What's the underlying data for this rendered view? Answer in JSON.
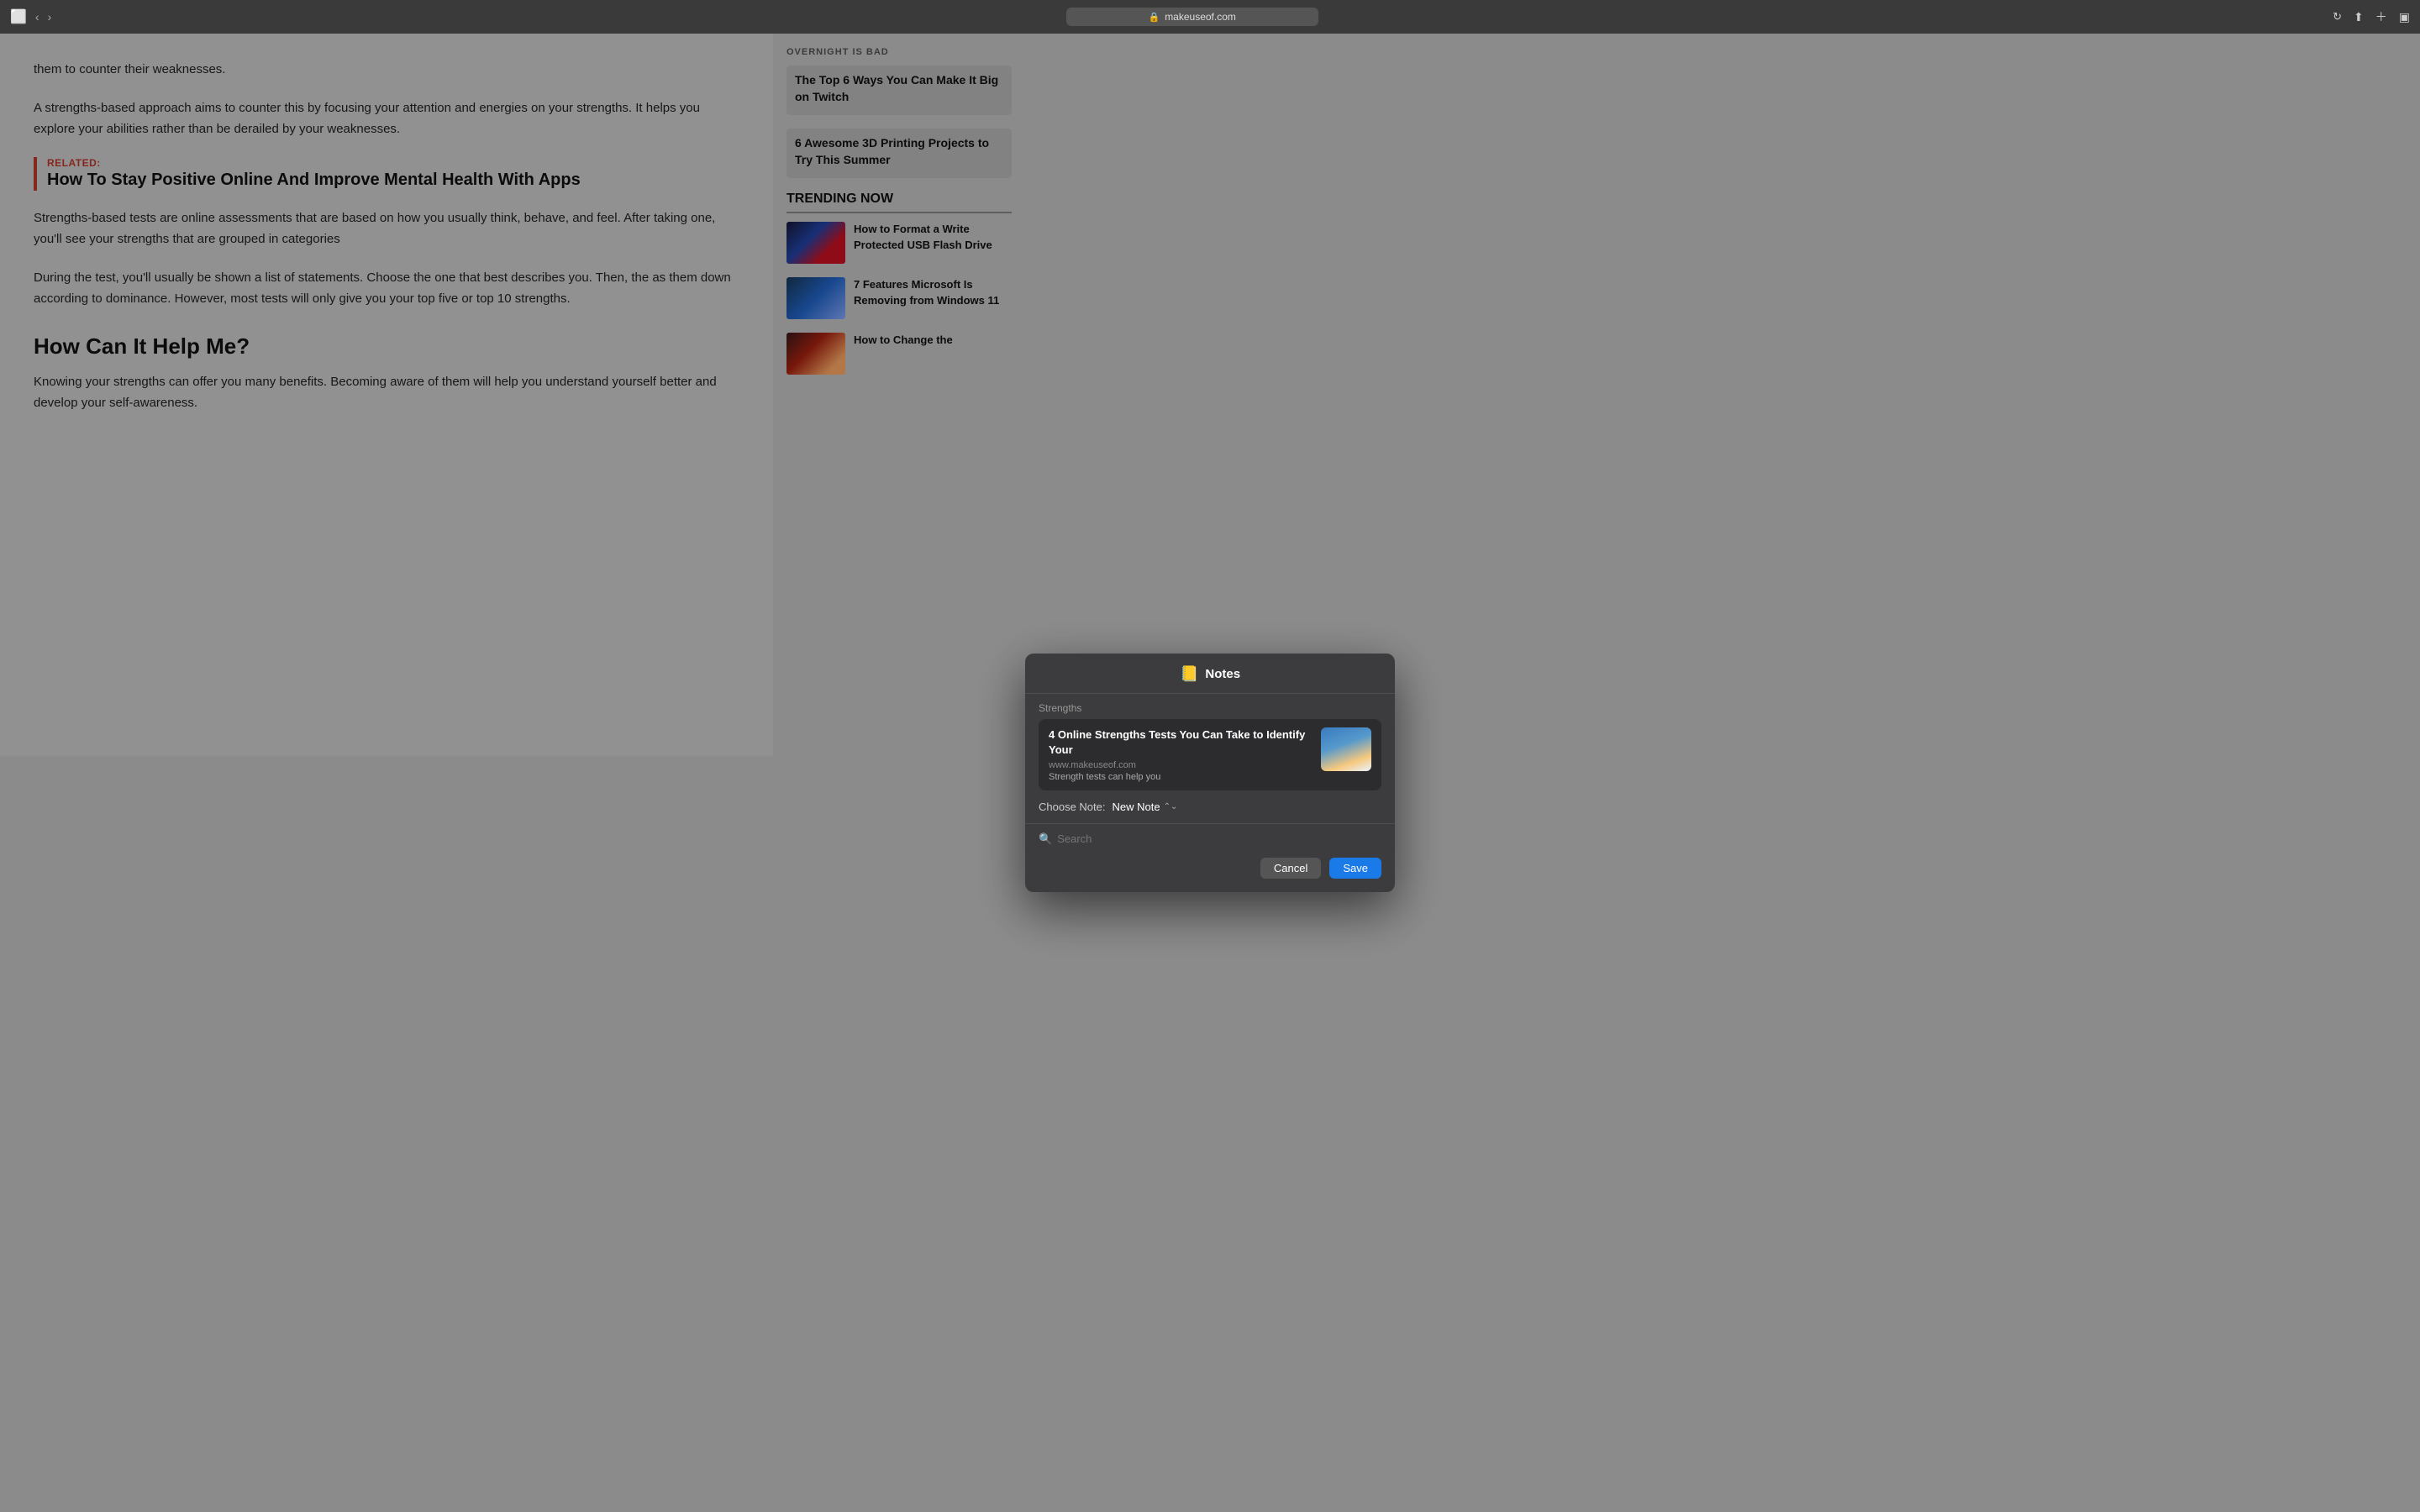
{
  "browser": {
    "url": "makeuseof.com",
    "lock_icon": "🔒",
    "reload_icon": "↻"
  },
  "article": {
    "paragraph1": "them to counter their weaknesses.",
    "paragraph2": "A strengths-based approach aims to counter this by focusing your attention and energies on your strengths. It helps you explore your abilities rather than be derailed by your weaknesses.",
    "related_label": "RELATED:",
    "related_link": "How To Stay Positive Online And Improve Mental Health With Apps",
    "paragraph3": "Strengths-based tests are online assessments that are based on how you usually think, behave, and feel. After taking one, you'll see your strengths that are grouped in categories",
    "paragraph4": "During the test, you'll usually be shown a list of statements. Choose the one that best describes you. Then, the as them down according to dominance. However, most tests will only give you your top five or top 10 strengths.",
    "section_heading": "How Can It Help Me?",
    "paragraph5": "Knowing your strengths can offer you many benefits. Becoming aware of them will help you understand yourself better and develop your self-awareness."
  },
  "sidebar": {
    "overnight_title": "Overnight Is Bad",
    "gamer_card_title": "The Top 6 Ways You Can Make It Big on Twitch",
    "print3d_card_title": "6 Awesome 3D Printing Projects to Try This Summer",
    "trending_label": "TRENDING NOW",
    "trending_items": [
      {
        "title": "How to Format a Write Protected USB Flash Drive",
        "thumb_class": "thumb-usb"
      },
      {
        "title": "7 Features Microsoft Is Removing from Windows 11",
        "thumb_class": "thumb-win"
      },
      {
        "title": "How to Change the",
        "thumb_class": "thumb-change"
      }
    ]
  },
  "notes_modal": {
    "title": "Notes",
    "icon": "📒",
    "section_label": "Strengths",
    "card_title": "4 Online Strengths Tests You Can Take to Identify Your",
    "card_url": "www.makeuseof.com",
    "card_preview": "Strength tests can help you",
    "choose_label": "Choose Note:",
    "choose_value": "New Note",
    "search_placeholder": "Search",
    "cancel_label": "Cancel",
    "save_label": "Save"
  }
}
